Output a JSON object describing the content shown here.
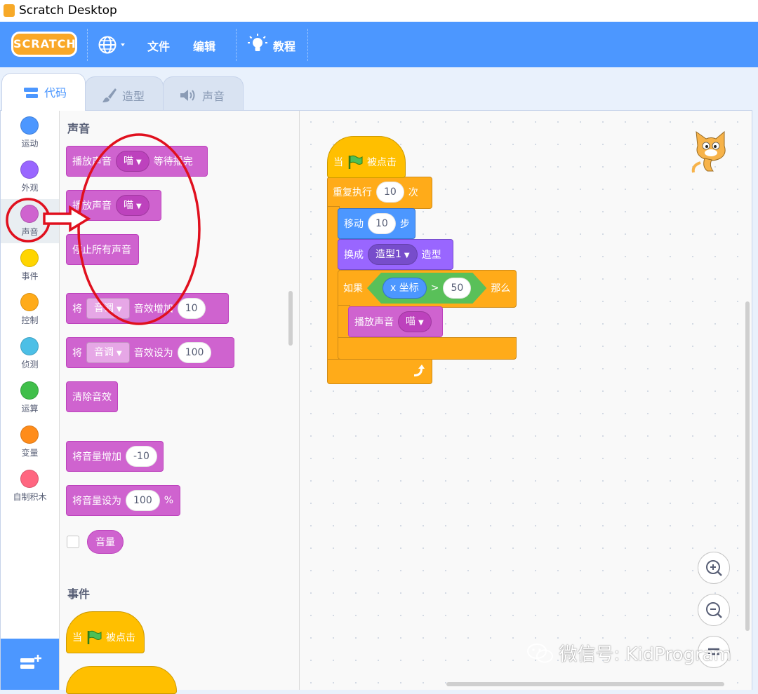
{
  "window": {
    "title": "Scratch Desktop"
  },
  "menubar": {
    "logo": "SCRATCH",
    "file": "文件",
    "edit": "编辑",
    "tutorials": "教程"
  },
  "tabs": [
    {
      "label": "代码",
      "active": true
    },
    {
      "label": "造型",
      "active": false
    },
    {
      "label": "声音",
      "active": false
    }
  ],
  "categories": [
    {
      "label": "运动",
      "color": "#4c97ff"
    },
    {
      "label": "外观",
      "color": "#9966ff"
    },
    {
      "label": "声音",
      "color": "#cf63cf"
    },
    {
      "label": "事件",
      "color": "#ffd500"
    },
    {
      "label": "控制",
      "color": "#ffab19"
    },
    {
      "label": "侦测",
      "color": "#4cbfe6"
    },
    {
      "label": "运算",
      "color": "#40bf4a"
    },
    {
      "label": "变量",
      "color": "#ff8c1a"
    },
    {
      "label": "自制积木",
      "color": "#ff6680"
    }
  ],
  "palette": {
    "sound_title": "声音",
    "play_until_done": {
      "a": "播放声音",
      "sound": "喵",
      "b": "等待播完"
    },
    "start_sound": {
      "a": "播放声音",
      "sound": "喵"
    },
    "stop_all": "停止所有声音",
    "change_effect": {
      "a": "将",
      "effect": "音调",
      "b": "音效增加",
      "value": "10"
    },
    "set_effect": {
      "a": "将",
      "effect": "音调",
      "b": "音效设为",
      "value": "100"
    },
    "clear_effects": "清除音效",
    "change_volume": {
      "a": "将音量增加",
      "value": "-10"
    },
    "set_volume": {
      "a": "将音量设为",
      "value": "100",
      "unit": "%"
    },
    "volume_reporter": "音量",
    "events_title": "事件",
    "flag_hat": {
      "a": "当",
      "b": "被点击"
    }
  },
  "script": {
    "hat": {
      "a": "当",
      "b": "被点击"
    },
    "repeat": {
      "a": "重复执行",
      "value": "10",
      "b": "次"
    },
    "move": {
      "a": "移动",
      "value": "10",
      "b": "步"
    },
    "switch_costume": {
      "a": "换成",
      "costume": "造型1",
      "b": "造型"
    },
    "if_then": {
      "a": "如果",
      "reporter": "x 坐标",
      "op": ">",
      "value": "50",
      "b": "那么"
    },
    "play_sound": {
      "a": "播放声音",
      "sound": "喵"
    }
  },
  "watermark": "微信号: KidProgram",
  "colors": {
    "accent": "#4c97ff",
    "sound": "#cf63cf",
    "annotation": "#e0101e"
  }
}
